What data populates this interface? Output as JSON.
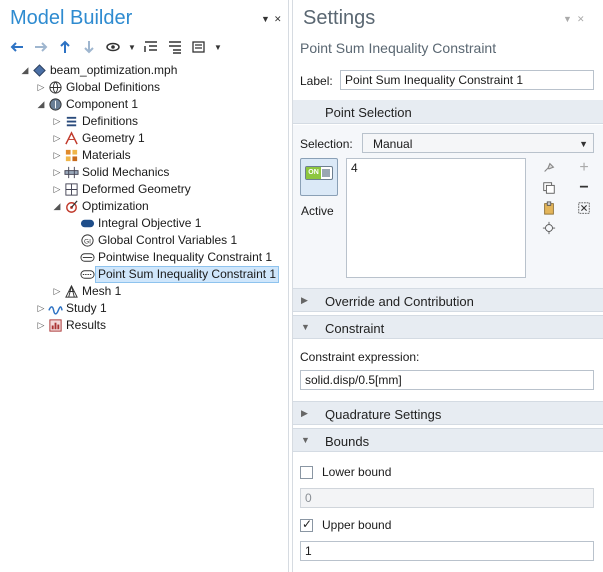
{
  "model_builder": {
    "title": "Model Builder",
    "tree": [
      {
        "label": "beam_optimization.mph",
        "icon": "model-file-icon",
        "exp": "open",
        "level": 0
      },
      {
        "label": "Global Definitions",
        "icon": "globe-icon",
        "exp": "closed",
        "level": 1
      },
      {
        "label": "Component 1",
        "icon": "component-icon",
        "exp": "open",
        "level": 1
      },
      {
        "label": "Definitions",
        "icon": "definitions-icon",
        "exp": "closed",
        "level": 2
      },
      {
        "label": "Geometry 1",
        "icon": "geometry-icon",
        "exp": "closed",
        "level": 2
      },
      {
        "label": "Materials",
        "icon": "materials-icon",
        "exp": "closed",
        "level": 2
      },
      {
        "label": "Solid Mechanics",
        "icon": "solid-mechanics-icon",
        "exp": "closed",
        "level": 2
      },
      {
        "label": "Deformed Geometry",
        "icon": "deformed-geometry-icon",
        "exp": "closed",
        "level": 2
      },
      {
        "label": "Optimization",
        "icon": "optimization-icon",
        "exp": "open",
        "level": 2
      },
      {
        "label": "Integral Objective 1",
        "icon": "integral-objective-icon",
        "exp": "none",
        "level": 3
      },
      {
        "label": "Global Control Variables 1",
        "icon": "global-control-variables-icon",
        "exp": "none",
        "level": 3
      },
      {
        "label": "Pointwise Inequality Constraint 1",
        "icon": "pointwise-constraint-icon",
        "exp": "none",
        "level": 3
      },
      {
        "label": "Point Sum Inequality Constraint 1",
        "icon": "point-sum-constraint-icon",
        "exp": "none",
        "level": 3,
        "selected": true
      },
      {
        "label": "Mesh 1",
        "icon": "mesh-icon",
        "exp": "closed",
        "level": 2
      },
      {
        "label": "Study 1",
        "icon": "study-icon",
        "exp": "closed",
        "level": 1
      },
      {
        "label": "Results",
        "icon": "results-icon",
        "exp": "closed",
        "level": 1
      }
    ]
  },
  "settings": {
    "title": "Settings",
    "subtitle": "Point Sum Inequality Constraint",
    "label_caption": "Label:",
    "label_value": "Point Sum Inequality Constraint 1",
    "point_selection": {
      "title": "Point Selection",
      "selection_caption": "Selection:",
      "selection_value": "Manual",
      "active_on_text": "ON",
      "active_label": "Active",
      "selected_points": "4"
    },
    "override_title": "Override and Contribution",
    "constraint": {
      "title": "Constraint",
      "expr_caption": "Constraint expression:",
      "expr_value": "solid.disp/0.5[mm]"
    },
    "quadrature_title": "Quadrature Settings",
    "bounds": {
      "title": "Bounds",
      "lower_label": "Lower bound",
      "lower_checked": false,
      "lower_value": "0",
      "upper_label": "Upper bound",
      "upper_checked": true,
      "upper_value": "1"
    }
  },
  "colors": {
    "accent": "#2e8bd0",
    "section_bg": "#e7ecf2",
    "selection_bg": "#cfe6fb"
  }
}
